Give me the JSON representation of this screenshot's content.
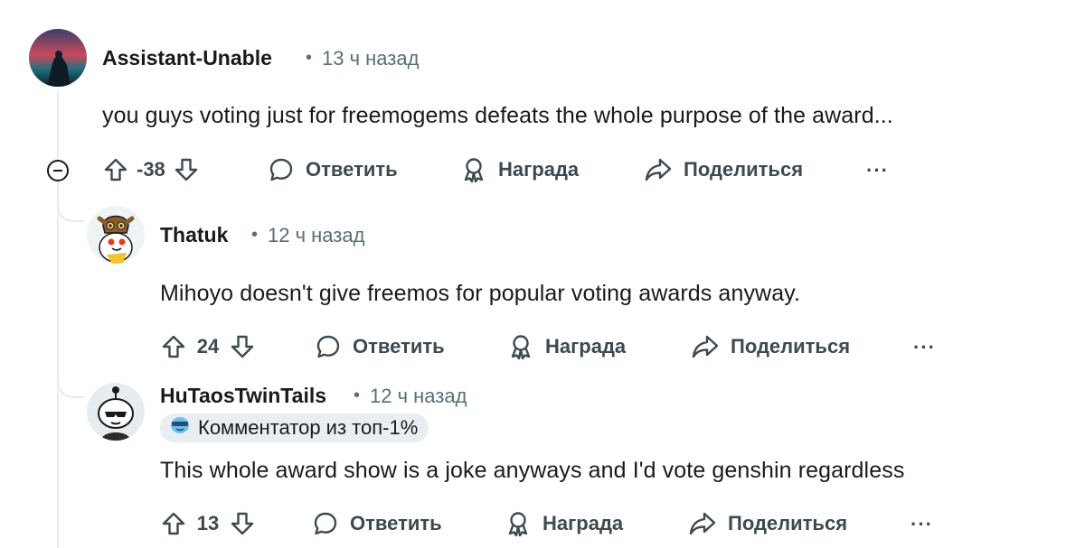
{
  "comments": [
    {
      "username": "Assistant-Unable",
      "separator": "•",
      "time": "13 ч назад",
      "body": "you guys voting just for freemogems defeats the whole purpose of the award...",
      "score": "-38",
      "actions": {
        "reply": "Ответить",
        "award": "Награда",
        "share": "Поделиться",
        "more": "···"
      }
    },
    {
      "username": "Thatuk",
      "separator": "•",
      "time": "12 ч назад",
      "body": "Mihoyo doesn't give freemos for popular voting awards anyway.",
      "score": "24",
      "actions": {
        "reply": "Ответить",
        "award": "Награда",
        "share": "Поделиться",
        "more": "···"
      }
    },
    {
      "username": "HuTaosTwinTails",
      "separator": "•",
      "time": "12 ч назад",
      "flair": "Комментатор из топ-1%",
      "body": "This whole award show is a joke anyways and I'd vote genshin regardless",
      "score": "13",
      "actions": {
        "reply": "Ответить",
        "award": "Награда",
        "share": "Поделиться",
        "more": "···"
      }
    }
  ],
  "icons": {
    "upvote": "arrow-up-outline-icon",
    "downvote": "arrow-down-outline-icon",
    "reply": "speech-bubble-icon",
    "award": "award-ribbon-icon",
    "share": "share-arrow-icon",
    "collapse": "minus-circle-icon",
    "flair": "sunglasses-emoji-icon"
  },
  "colors": {
    "text": "#1a1a1b",
    "meta": "#576f76",
    "action": "#3c4a50",
    "thread_line": "#e5ebee",
    "badge_bg": "#e8eef1"
  }
}
